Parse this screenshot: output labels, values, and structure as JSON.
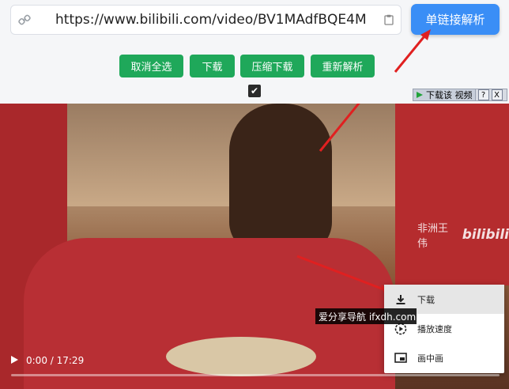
{
  "url_input": {
    "value": "https://www.bilibili.com/video/BV1MAdfBQE4M"
  },
  "parse_button": "单链接解析",
  "buttons": {
    "deselect_all": "取消全选",
    "download": "下载",
    "zip_download": "压缩下载",
    "reparse": "重新解析"
  },
  "checkbox": {
    "checked": true
  },
  "video": {
    "download_bar_label": "下载该 视频",
    "download_bar_help": "?",
    "download_bar_close": "X",
    "watermark_text": "非洲王伟",
    "watermark_logo": "bilibili",
    "time": "0:00 / 17:29",
    "progress": 0.0
  },
  "context_menu": {
    "items": [
      {
        "label": "下载",
        "icon": "download-icon"
      },
      {
        "label": "播放速度",
        "icon": "speed-icon"
      },
      {
        "label": "画中画",
        "icon": "pip-icon"
      }
    ]
  },
  "site_overlay": "爱分享导航 ifxdh.com",
  "colors": {
    "accent_blue": "#3a8ef6",
    "green": "#1fa85a",
    "arrow_red": "#e02020"
  }
}
